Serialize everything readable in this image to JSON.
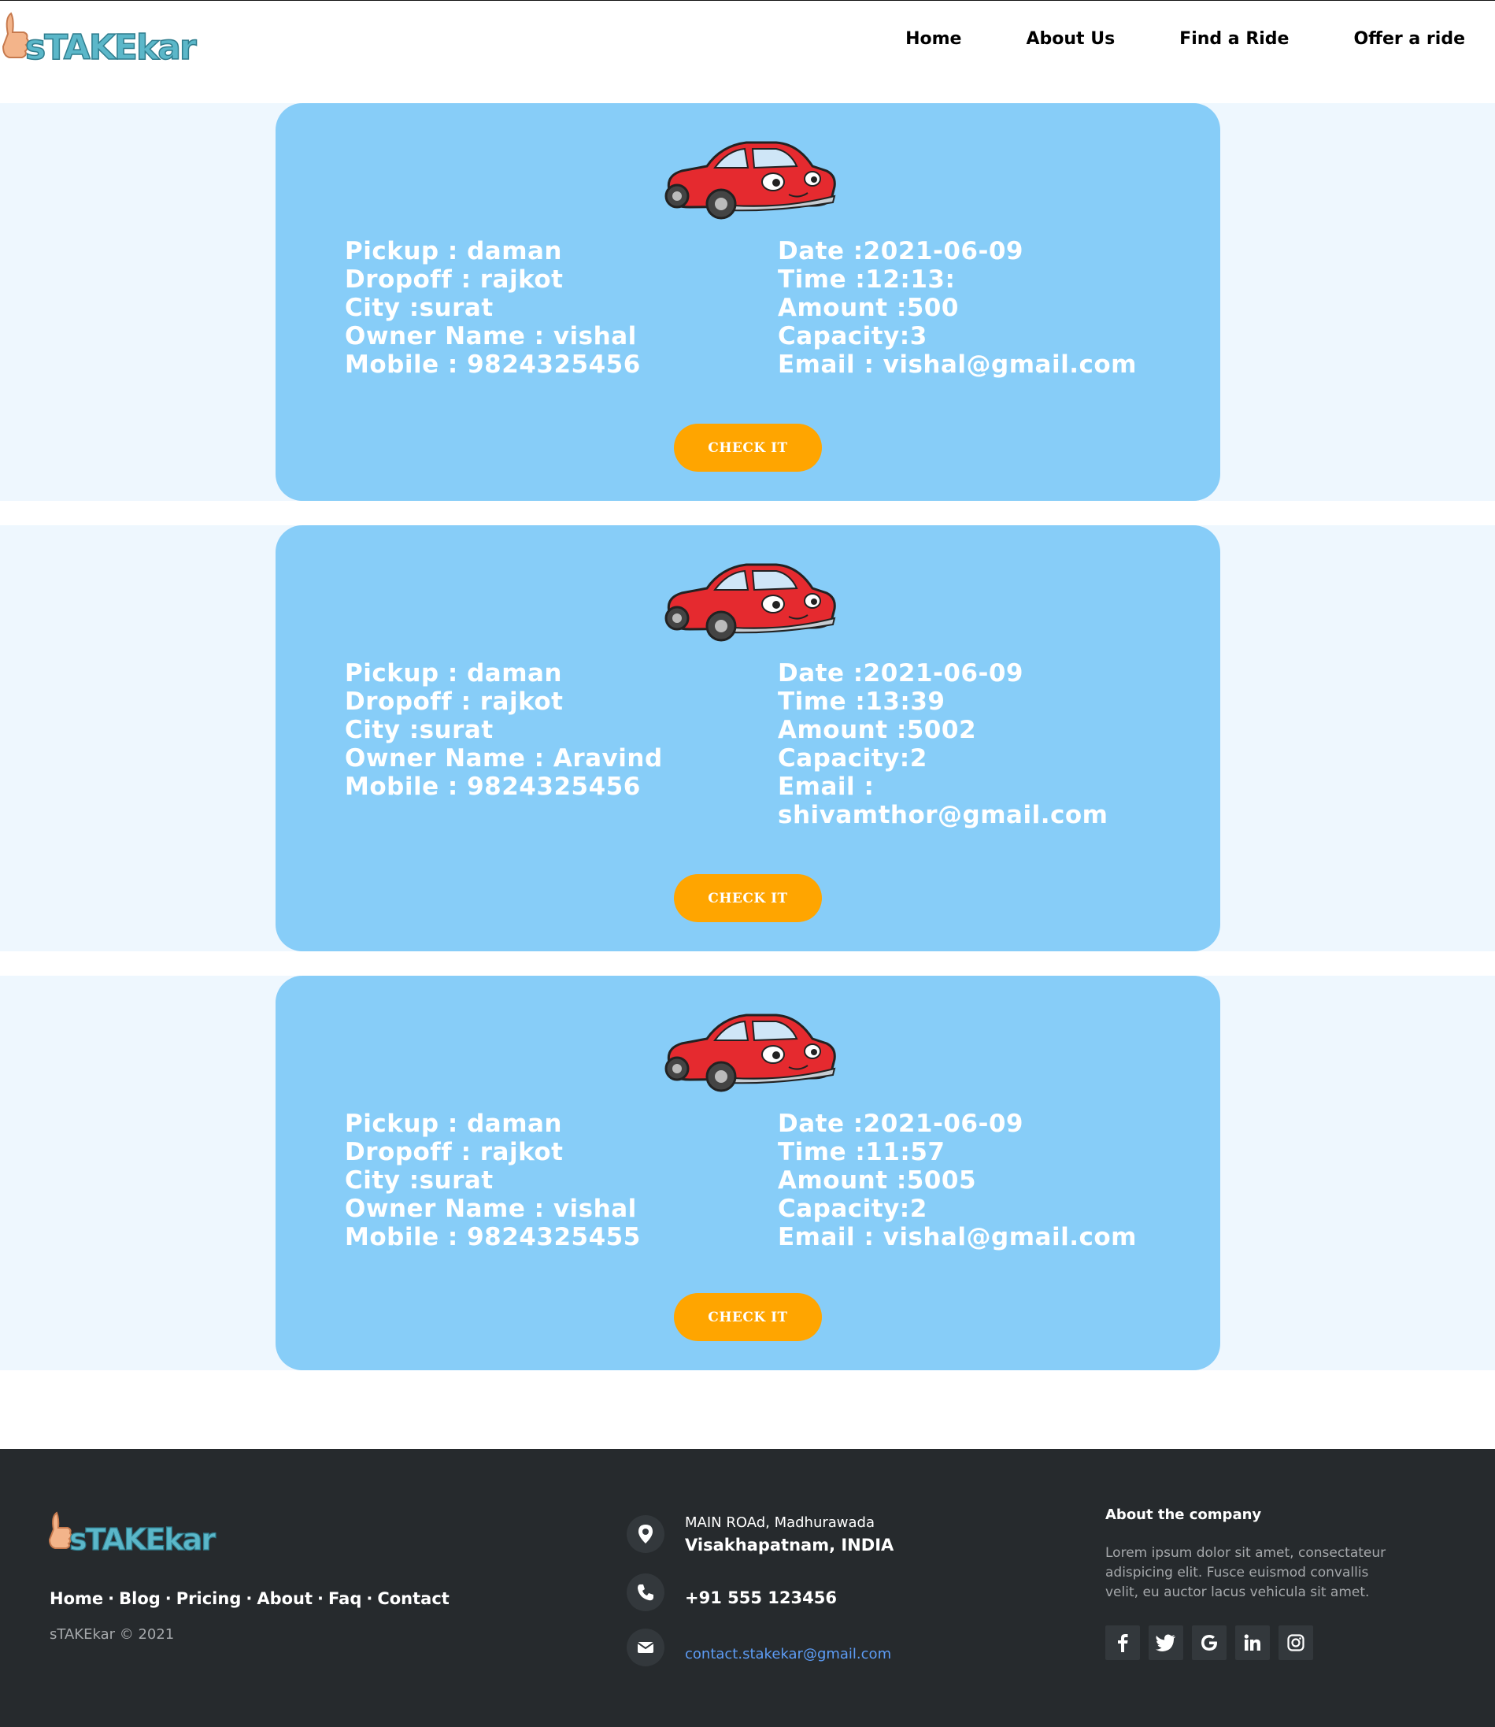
{
  "header": {
    "logo_text": "sTAKEkar",
    "nav": [
      "Home",
      "About Us",
      "Find a Ride",
      "Offer a ride"
    ]
  },
  "rides": [
    {
      "left": [
        "Pickup : daman",
        "Dropoff : rajkot",
        "City :surat",
        "Owner Name : vishal",
        "Mobile : 9824325456"
      ],
      "right": [
        "Date :2021-06-09",
        "Time :12:13:",
        "Amount :500",
        "Capacity:3",
        "Email : vishal@gmail.com"
      ],
      "button": "CHECK IT"
    },
    {
      "left": [
        "Pickup : daman",
        "Dropoff : rajkot",
        "City :surat",
        "Owner Name : Aravind",
        "Mobile : 9824325456"
      ],
      "right": [
        "Date :2021-06-09",
        "Time :13:39",
        "Amount :5002",
        "Capacity:2",
        "Email : shivamthor@gmail.com"
      ],
      "button": "CHECK IT"
    },
    {
      "left": [
        "Pickup : daman",
        "Dropoff : rajkot",
        "City :surat",
        "Owner Name : vishal",
        "Mobile : 9824325455"
      ],
      "right": [
        "Date :2021-06-09",
        "Time :11:57",
        "Amount :5005",
        "Capacity:2",
        "Email : vishal@gmail.com"
      ],
      "button": "CHECK IT"
    }
  ],
  "footer": {
    "links": [
      "Home",
      "Blog",
      "Pricing",
      "About",
      "Faq",
      "Contact"
    ],
    "separator": "·",
    "copyright": "sTAKEkar © 2021",
    "address_line1": "MAIN ROAd, Madhurawada",
    "address_line2": "Visakhapatnam, INDIA",
    "phone": "+91 555 123456",
    "email": "contact.stakekar@gmail.com",
    "about_title": "About the company",
    "about_text": "Lorem ipsum dolor sit amet, consectateur adispicing elit. Fusce euismod convallis velit, eu auctor lacus vehicula sit amet.",
    "socials": [
      "facebook-icon",
      "twitter-icon",
      "google-icon",
      "linkedin-icon",
      "instagram-icon"
    ]
  },
  "colors": {
    "card": "#87cdf8",
    "band": "#eef7fe",
    "button": "#ffa500",
    "footer": "#262a2d",
    "email_link": "#5d9cf5"
  }
}
